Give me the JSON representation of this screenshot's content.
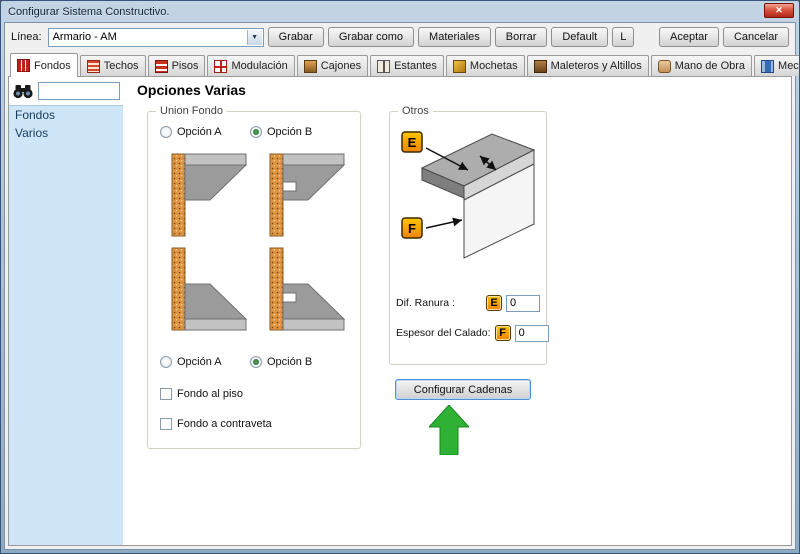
{
  "window": {
    "title": "Configurar Sistema Constructivo."
  },
  "icons": {
    "dropdown_arrow": "▼",
    "close": "✕"
  },
  "toolbar": {
    "linea_label": "Línea:",
    "combo_value": "Armario - AM",
    "buttons": [
      "Grabar",
      "Grabar como",
      "Materiales",
      "Borrar",
      "Default",
      "L"
    ],
    "aceptar": "Aceptar",
    "cancelar": "Cancelar"
  },
  "tabs": [
    {
      "label": "Fondos",
      "selected": true
    },
    {
      "label": "Techos",
      "selected": false
    },
    {
      "label": "Pisos",
      "selected": false
    },
    {
      "label": "Modulación",
      "selected": false
    },
    {
      "label": "Cajones",
      "selected": false
    },
    {
      "label": "Estantes",
      "selected": false
    },
    {
      "label": "Mochetas",
      "selected": false
    },
    {
      "label": "Maleteros y Altillos",
      "selected": false
    },
    {
      "label": "Mano de Obra",
      "selected": false
    },
    {
      "label": "Mecanizados",
      "selected": false
    }
  ],
  "sidebar": {
    "search_value": "",
    "items": [
      "Fondos",
      "Varios"
    ]
  },
  "main": {
    "heading": "Opciones Varias",
    "union_fondo": {
      "title": "Union Fondo",
      "radio_top": [
        {
          "label": "Opción A",
          "checked": false
        },
        {
          "label": "Opción B",
          "checked": true
        }
      ],
      "radio_bottom": [
        {
          "label": "Opción A",
          "checked": false
        },
        {
          "label": "Opción B",
          "checked": true
        }
      ],
      "checkboxes": [
        {
          "label": "Fondo al piso",
          "checked": false
        },
        {
          "label": "Fondo a contraveta",
          "checked": false
        }
      ]
    },
    "otros": {
      "title": "Otros",
      "fields": [
        {
          "label": "Dif. Ranura :",
          "badge": "E",
          "value": "0"
        },
        {
          "label": "Espesor del Calado:",
          "badge": "F",
          "value": "0"
        }
      ]
    },
    "configurar_cadenas_label": "Configurar Cadenas"
  },
  "colors": {
    "accent_green": "#2eb135",
    "badge_orange": "#f59d00",
    "sidebar_blue": "#cfe6f8",
    "tab_icon_red": "#cc2218"
  }
}
